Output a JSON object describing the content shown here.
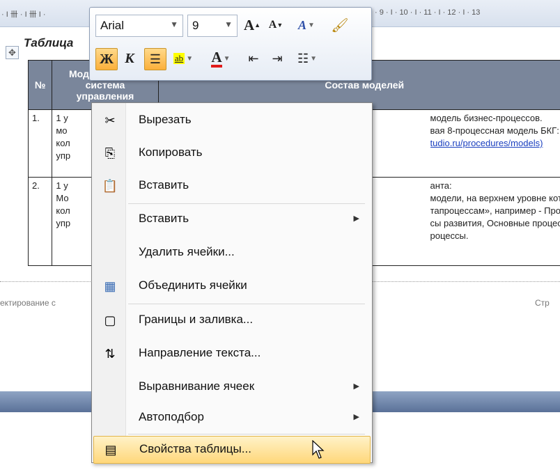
{
  "ruler": {
    "left": "· I 卌 · I 卌 I ·",
    "right": "· 9 · I · 10 · I · 11 · I · 12 · I · 13"
  },
  "document": {
    "caption": "Таблица",
    "table_anchor_icon": "move-cross-icon",
    "table": {
      "headers": [
        "№",
        "Моделируемая система управления",
        "Состав моделей"
      ],
      "rows": [
        {
          "num": "1.",
          "col2": [
            "1 у",
            "мо",
            "кол",
            "упр"
          ],
          "col3": [
            "модель бизнес-процессов.",
            "вая 8-процессная модель БКГ:",
            "tudio.ru/procedures/models)"
          ]
        },
        {
          "num": "2.",
          "col2": [
            "1 у",
            "Мо",
            "кол",
            "упр"
          ],
          "col3": [
            "анта:",
            "модели, на верхнем уровне кото",
            "тапроцессам», например - Проц",
            "сы развития, Основные процесс",
            "роцессы."
          ]
        }
      ]
    },
    "footer_left": "ектирование с",
    "footer_right": "Стр"
  },
  "mini_toolbar": {
    "font": "Arial",
    "size": "9",
    "grow_font": "A",
    "shrink_font": "A",
    "styles": "A",
    "bold": "Ж",
    "italic": "К",
    "highlight": "ab",
    "font_color": "A"
  },
  "context_menu": {
    "items": [
      {
        "label": "Вырезать",
        "icon": "scissors-icon",
        "glyph": "✂"
      },
      {
        "label": "Копировать",
        "icon": "copy-icon",
        "glyph": "⎘"
      },
      {
        "label": "Вставить",
        "icon": "paste-icon",
        "glyph": "📋"
      },
      {
        "label": "Вставить",
        "icon": "",
        "glyph": "",
        "submenu": true
      },
      {
        "label": "Удалить ячейки...",
        "icon": "",
        "glyph": ""
      },
      {
        "label": "Объединить ячейки",
        "icon": "merge-cells-icon",
        "glyph": "▦"
      },
      {
        "label": "Границы и заливка...",
        "icon": "borders-icon",
        "glyph": "▢"
      },
      {
        "label": "Направление текста...",
        "icon": "text-direction-icon",
        "glyph": "⇅"
      },
      {
        "label": "Выравнивание ячеек",
        "icon": "",
        "glyph": "",
        "submenu": true
      },
      {
        "label": "Автоподбор",
        "icon": "",
        "glyph": "",
        "submenu": true
      },
      {
        "label": "Свойства таблицы...",
        "icon": "table-properties-icon",
        "glyph": "▤",
        "highlighted": true
      }
    ]
  }
}
